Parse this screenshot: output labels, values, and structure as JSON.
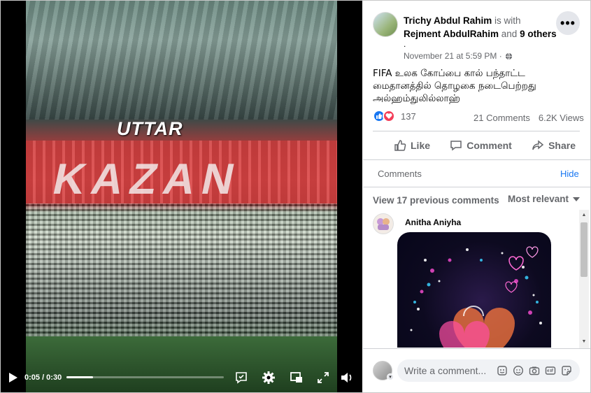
{
  "video": {
    "overlay_title": "UTTAR",
    "banner_text": "KAZAN",
    "time": "0:05 / 0:30",
    "progress": 0.17
  },
  "post": {
    "author": "Trichy Abdul Rahim",
    "with_text": "is with",
    "tagged": "Rejment AbdulRahim",
    "and_text": "and",
    "others": "9 others",
    "dot": ".",
    "time": "November 21 at 5:59 PM ·",
    "text": "FIFA உலக கோப்பை கால் பந்தாட்ட மைதானத்தில் தொழகை நடைபெற்றது அல்ஹம்துலில்லாஹ்",
    "reaction_count": "137",
    "comments_count": "21 Comments",
    "views": "6.2K Views",
    "actions": {
      "like": "Like",
      "comment": "Comment",
      "share": "Share"
    },
    "more": "•••"
  },
  "comments": {
    "label": "Comments",
    "hide": "Hide",
    "view_previous": "View 17 previous comments",
    "sort": "Most relevant",
    "items": [
      {
        "author": "Anitha Aniyha"
      }
    ],
    "composer_placeholder": "Write a comment..."
  },
  "colors": {
    "link": "#1877f2",
    "like": "#1877f2",
    "love": "#f33e58",
    "muted": "#65676b"
  }
}
